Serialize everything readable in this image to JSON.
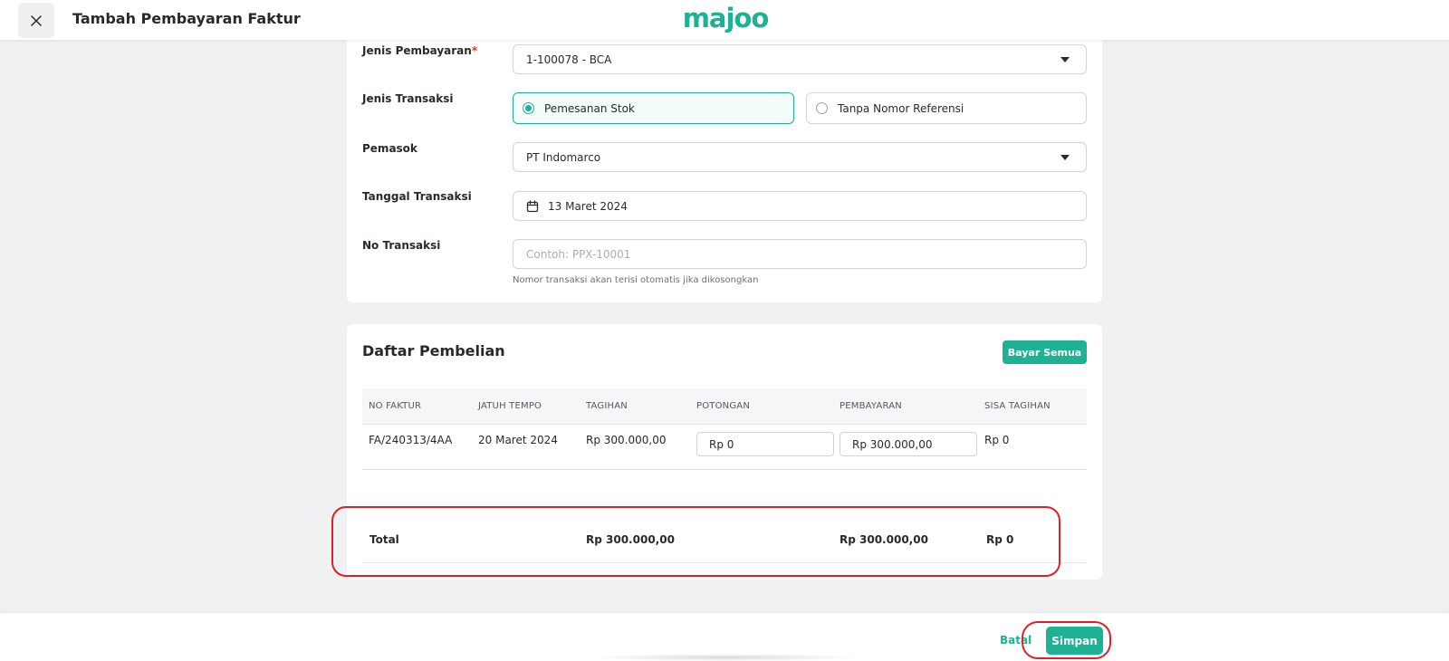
{
  "header": {
    "title": "Tambah Pembayaran Faktur",
    "logo_text": "majoo"
  },
  "form": {
    "payment_type": {
      "label": "Jenis Pembayaran",
      "required_mark": "*",
      "value": "1-100078 - BCA"
    },
    "transaction_type": {
      "label": "Jenis Transaksi",
      "options": [
        {
          "label": "Pemesanan Stok",
          "selected": true
        },
        {
          "label": "Tanpa Nomor Referensi",
          "selected": false
        }
      ]
    },
    "supplier": {
      "label": "Pemasok",
      "value": "PT Indomarco"
    },
    "transaction_date": {
      "label": "Tanggal Transaksi",
      "value": "13 Maret 2024"
    },
    "transaction_no": {
      "label": "No Transaksi",
      "placeholder": "Contoh: PPX-10001",
      "helper": "Nomor transaksi akan terisi otomatis jika dikosongkan"
    }
  },
  "purchase_list": {
    "title": "Daftar Pembelian",
    "pay_all_label": "Bayar Semua",
    "columns": [
      "NO FAKTUR",
      "JATUH TEMPO",
      "TAGIHAN",
      "POTONGAN",
      "PEMBAYARAN",
      "SISA TAGIHAN"
    ],
    "rows": [
      {
        "invoice_no": "FA/240313/4AA",
        "due_date": "20 Maret 2024",
        "bill": "Rp 300.000,00",
        "discount": "Rp 0",
        "payment": "Rp 300.000,00",
        "remaining": "Rp 0"
      }
    ],
    "total": {
      "label": "Total",
      "bill": "Rp 300.000,00",
      "payment": "Rp 300.000,00",
      "remaining": "Rp 0"
    }
  },
  "footer": {
    "cancel_label": "Batal",
    "save_label": "Simpan"
  },
  "colors": {
    "accent": "#1fb193",
    "highlight": "#e01f26",
    "required": "#e0322d"
  }
}
